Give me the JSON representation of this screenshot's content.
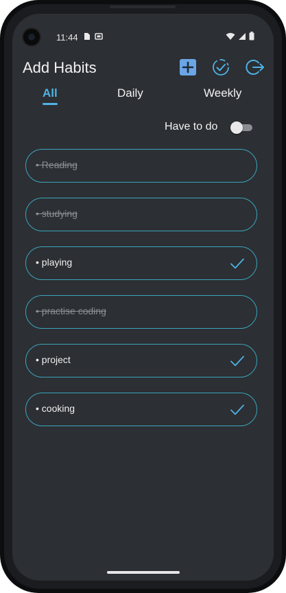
{
  "status": {
    "time": "11:44"
  },
  "header": {
    "title": "Add Habits"
  },
  "tabs": [
    {
      "label": "All",
      "active": true
    },
    {
      "label": "Daily",
      "active": false
    },
    {
      "label": "Weekly",
      "active": false
    }
  ],
  "filter": {
    "label": "Have to do",
    "toggle_on": false
  },
  "habits": [
    {
      "text": "• Reading",
      "completed": true
    },
    {
      "text": "• studying",
      "completed": true
    },
    {
      "text": "• playing",
      "completed": false
    },
    {
      "text": "• practise coding",
      "completed": true
    },
    {
      "text": "• project",
      "completed": false
    },
    {
      "text": "• cooking",
      "completed": false
    }
  ],
  "icons": {
    "add": "plus-square-icon",
    "progress": "check-circle-dashed-icon",
    "logout": "logout-icon",
    "item_check": "checkmark-icon"
  },
  "colors": {
    "accent": "#4fb3e6",
    "item_border": "#3aa6bf",
    "background": "#2c2f33",
    "add_button": "#6aa5e6"
  }
}
